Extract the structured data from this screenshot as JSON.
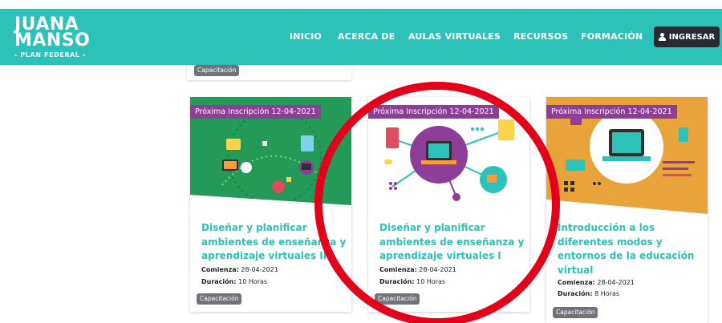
{
  "header": {
    "logo_line1": "JUANA",
    "logo_line2": "MANSO",
    "logo_sub": "- PLAN FEDERAL -",
    "nav": [
      "INICIO",
      "ACERCA DE",
      "AULAS VIRTUALES",
      "RECURSOS",
      "FORMACIÓN"
    ],
    "login_label": "INGRESAR"
  },
  "prev_card": {
    "tag": "Capacitación"
  },
  "cards": [
    {
      "ribbon": "Próxima Inscripción 12-04-2021",
      "title_lines": [
        "Diseñar y planificar",
        "ambientes de enseñanza y",
        "aprendizaje virtuales II"
      ],
      "start_label": "Comienza:",
      "start_value": "28-04-2021",
      "duration_label": "Duración:",
      "duration_value": "10 Horas",
      "tag": "Capacitación"
    },
    {
      "ribbon": "Próxima Inscripción 12-04-2021",
      "title_lines": [
        "Diseñar y planificar",
        "ambientes de enseñanza y",
        "aprendizaje virtuales I"
      ],
      "start_label": "Comienza:",
      "start_value": "28-04-2021",
      "duration_label": "Duración:",
      "duration_value": "10 Horas",
      "tag": "Capacitación"
    },
    {
      "ribbon": "Próxima Inscripción 12-04-2021",
      "title_lines": [
        "Introducción a los",
        "diferentes modos y",
        "entornos de la educación",
        "virtual"
      ],
      "start_label": "Comienza:",
      "start_value": "28-04-2021",
      "duration_label": "Duración:",
      "duration_value": "8 Horas",
      "tag": "Capacitación"
    }
  ],
  "colors": {
    "header_bg": "#2cc2b9",
    "title": "#2cc2b9",
    "ribbon": "#8e3d98",
    "tag": "#6f7279",
    "highlight_circle": "#e3001b",
    "card1_image_green": "#239a58",
    "card3_image_orange": "#e8a43a"
  }
}
